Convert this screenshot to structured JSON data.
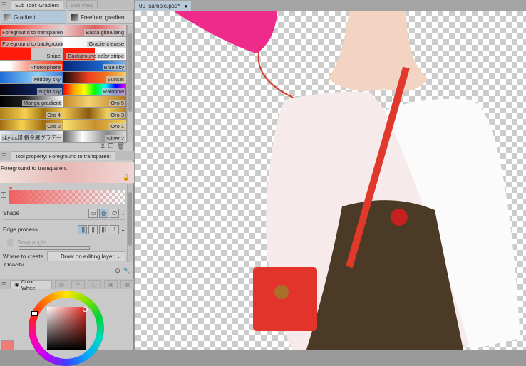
{
  "subtool": {
    "title": "Sub Tool: Gradient",
    "subview": "Sub View"
  },
  "groups": [
    {
      "label": "Gradient"
    },
    {
      "label": "Freeform gradient"
    }
  ],
  "gradients": [
    {
      "label": "Foreground to transparent",
      "bg": "linear-gradient(90deg,#ff2a1a,#f2a0a0 70%,#e0d0d0)"
    },
    {
      "label": "Basta gitna lang",
      "bg": "linear-gradient(90deg,#e8c8c8,#e06060 50%,#e8c8c8)"
    },
    {
      "label": "Foreground to background",
      "bg": "linear-gradient(90deg,#ff2a1a,#f0f0f0)"
    },
    {
      "label": "Gradient erase",
      "bg": "linear-gradient(90deg,#fff,#ddd)"
    },
    {
      "label": "Stripe",
      "bg": "linear-gradient(90deg,#ff1a0a 50%,#c8c8c8 50%)"
    },
    {
      "label": "Background color stripe",
      "bg": "linear-gradient(90deg,#ff1a0a 50%,#fff 50%)"
    },
    {
      "label": "Photosphere",
      "bg": "linear-gradient(90deg,#fff,#fff 15%,#f6a08a 45%,#ff2a10)"
    },
    {
      "label": "Blue sky",
      "bg": "linear-gradient(90deg,#06247a,#1a64c8 60%,#7cb7e8)"
    },
    {
      "label": "Midday sky",
      "bg": "linear-gradient(90deg,#1d6cd8,#8fd2f5 60%,#3d7ad4)"
    },
    {
      "label": "Sunset",
      "bg": "linear-gradient(90deg,#120808,#f04020 40%,#f07a20 70%,#f8d060)"
    },
    {
      "label": "Night sky",
      "bg": "linear-gradient(90deg,#050510,#0c1c50 50%,#14347c)"
    },
    {
      "label": "Rainbow",
      "bg": "linear-gradient(90deg,red,orange,yellow,lime,cyan,blue,magenta)"
    },
    {
      "label": "Manga gradient",
      "bg": "linear-gradient(90deg,#000,#222 40%,#fff)"
    },
    {
      "label": "Oro 5",
      "bg": "linear-gradient(90deg,#c48a2a,#f4d070 40%,#b07a20)"
    },
    {
      "label": "Oro 4",
      "bg": "linear-gradient(90deg,#b0801a,#f4d050 40%,#a07010 70%,#f0c850)"
    },
    {
      "label": "Oro 3",
      "bg": "linear-gradient(90deg,#f0c850,#8a5a10 40%,#f0d060 70%,#b08020)"
    },
    {
      "label": "Oro 2",
      "bg": "linear-gradient(90deg,#a06c10,#f4d050 35%,#a06a10 70%,#d8a838)"
    },
    {
      "label": "Oro 1",
      "bg": "linear-gradient(90deg,#f8e070,#c89030 50%,#f4d050)"
    },
    {
      "label": "skyfox印 銀金属グラデー",
      "bg": "linear-gradient(90deg,#e8eef4,#a0b0c8 50%,#f0f0f0)"
    },
    {
      "label": "Silver 2",
      "bg": "linear-gradient(90deg,#606060,#fff 30%,#888 70%,#ddd)"
    }
  ],
  "toolprop": {
    "title": "Tool property: Foreground to transparent",
    "preset": "Foreground to transparent",
    "shape_label": "Shape",
    "edge_label": "Edge process",
    "snap_label": "Snap angle",
    "where_label": "Where to create",
    "where_value": "Draw on editing layer",
    "opacity_label": "Opacity"
  },
  "colorpanel": {
    "title": "Color Wheel",
    "current_color": "#f07c78",
    "hue_color": "#e8281e"
  },
  "document": {
    "tab": "00_sample.psd*"
  }
}
